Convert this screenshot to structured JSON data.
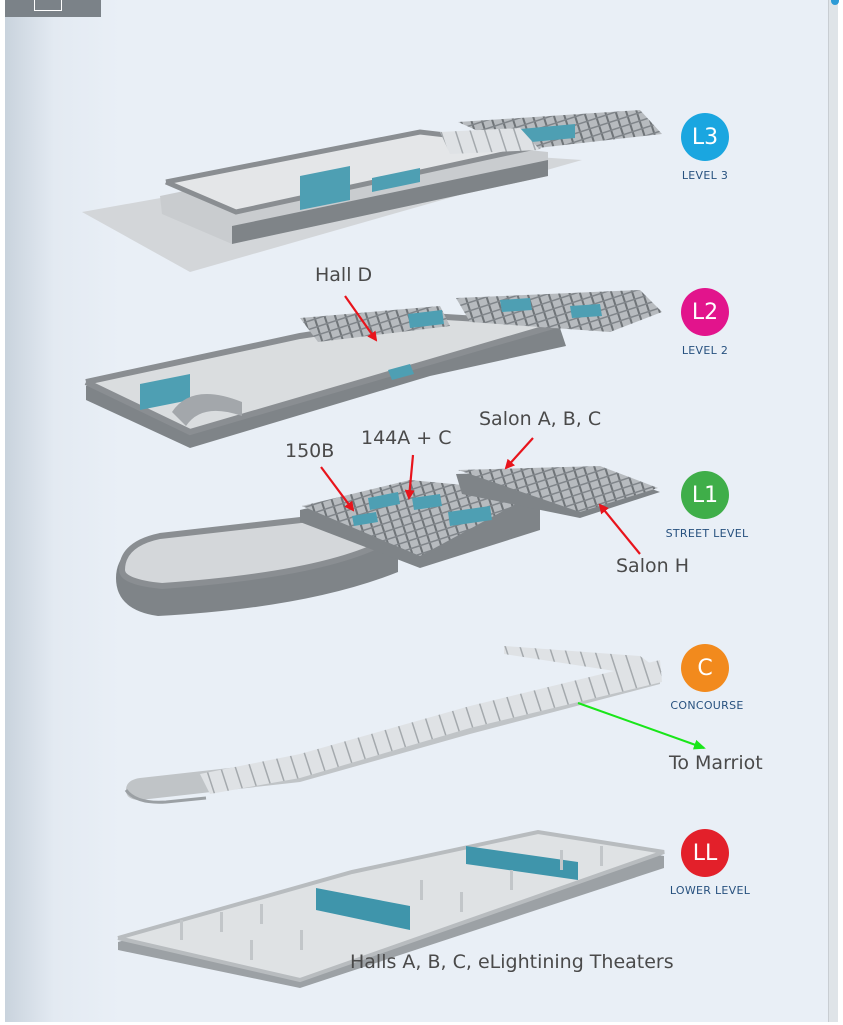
{
  "levels": [
    {
      "code": "L3",
      "name": "LEVEL 3",
      "color": "#1aa6e0"
    },
    {
      "code": "L2",
      "name": "LEVEL 2",
      "color": "#e2148c"
    },
    {
      "code": "L1",
      "name": "STREET LEVEL",
      "color": "#3fae49"
    },
    {
      "code": "C",
      "name": "CONCOURSE",
      "color": "#f28a1d"
    },
    {
      "code": "LL",
      "name": "LOWER LEVEL",
      "color": "#e3202a"
    }
  ],
  "annotations": {
    "hall_d": "Hall D",
    "salon_abc": "Salon A, B, C",
    "room_144": "144A + C",
    "room_150": "150B",
    "salon_h": "Salon H",
    "to_marriot": "To Marriot",
    "lower_halls": "Halls A, B, C, eLightining Theaters"
  },
  "colors": {
    "arrow_red": "#e8141c",
    "arrow_green": "#19e619",
    "floor_light": "#d9dcdf",
    "wall_grey": "#8b8f93",
    "room_teal": "#4fa6b8"
  }
}
